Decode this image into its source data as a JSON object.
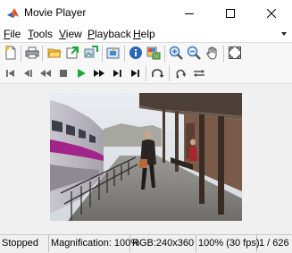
{
  "window": {
    "title": "Movie Player",
    "controls": [
      "minimize",
      "maximize",
      "close"
    ]
  },
  "menu": {
    "items": [
      {
        "label_u": "F",
        "label_rest": "ile"
      },
      {
        "label_u": "T",
        "label_rest": "ools"
      },
      {
        "label_u": "V",
        "label_rest": "iew"
      },
      {
        "label_u": "P",
        "label_rest": "layback"
      },
      {
        "label_u": "H",
        "label_rest": "elp"
      }
    ]
  },
  "toolbar_file": [
    "new-file-icon",
    "print-icon",
    "open-folder-icon",
    "export-icon",
    "image-export-icon",
    "import-video-icon",
    "info-icon",
    "colormap-icon",
    "zoom-in-icon",
    "zoom-out-icon",
    "pan-hand-icon",
    "fit-to-window-icon"
  ],
  "toolbar_playback": [
    "go-to-start-icon",
    "previous-frame-icon",
    "rewind-icon",
    "stop-icon",
    "play-icon",
    "fast-forward-icon",
    "next-frame-icon",
    "go-to-end-icon",
    "jump-to-icon",
    "loop-icon",
    "play-back-and-forth-icon"
  ],
  "colors": {
    "play_accent": "#1aaa3c",
    "zoom_accent": "#3a78c8",
    "window_bg": "#f0f0f0"
  },
  "video": {
    "description_alt": "Train station platform frame"
  },
  "status": {
    "state": "Stopped",
    "magnification": "Magnification: 100%",
    "format": "RGB:240x360",
    "speed": "100% (30 fps)",
    "frame": "1 / 626"
  }
}
